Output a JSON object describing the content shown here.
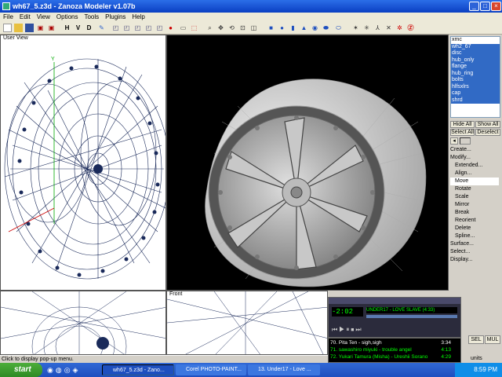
{
  "window": {
    "title": "wh67_5.z3d - Zanoza Modeler v1.07b"
  },
  "menu": [
    "File",
    "Edit",
    "View",
    "Options",
    "Tools",
    "Plugins",
    "Help"
  ],
  "toolbar_text_buttons": [
    "H",
    "V",
    "D"
  ],
  "viewports": {
    "top_left": "User View",
    "bottom_left": "",
    "bottom_mid": "Front"
  },
  "objects": [
    "xmc",
    "wh2_67",
    "disc",
    "hub_only",
    "flange",
    "hub_ring",
    "bolts",
    "hlfsxlrs",
    "cap",
    "shrd"
  ],
  "panel": {
    "hide_all": "Hide All",
    "show_all": "Show All",
    "select_all": "Select All",
    "deselect": "Deselect"
  },
  "commands": [
    {
      "label": "Create...",
      "sub": false
    },
    {
      "label": "Modify...",
      "sub": false
    },
    {
      "label": "Extended...",
      "sub": true
    },
    {
      "label": "Align...",
      "sub": true
    },
    {
      "label": "Move",
      "sub": true,
      "selected": true
    },
    {
      "label": "Rotate",
      "sub": true
    },
    {
      "label": "Scale",
      "sub": true
    },
    {
      "label": "Mirror",
      "sub": true
    },
    {
      "label": "Break",
      "sub": true
    },
    {
      "label": "Reorient",
      "sub": true
    },
    {
      "label": "Delete",
      "sub": true
    },
    {
      "label": "Spline...",
      "sub": true
    },
    {
      "label": "Surface...",
      "sub": false
    },
    {
      "label": "Select...",
      "sub": false
    },
    {
      "label": "Display...",
      "sub": false
    }
  ],
  "bottom_buttons": [
    "SEL",
    "MUL"
  ],
  "units_label": "units",
  "status_text": "Click to display pop-up menu.",
  "taskbar": {
    "start": "start",
    "tasks": [
      "wh67_5.z3d - Zano...",
      "Corel PHOTO-PAINT...",
      "13. Under17 - Love ..."
    ],
    "clock": "8:59 PM"
  },
  "winamp": {
    "time": "-2:02",
    "title_scroll": "UNDER17 - LOVE SLAVE (4:33)",
    "playlist": [
      {
        "text": "70. Pita Ten - sigh,sigh",
        "time": "3:34"
      },
      {
        "text": "71. sawashiro miyuki - trouble angel",
        "time": "4:13"
      },
      {
        "text": "72. Yukari Tamura (Misha) - Ureshii Sorano",
        "time": "4:29"
      }
    ]
  },
  "colors": {
    "selected": "#316ac5",
    "wire": "#1a2a5a"
  }
}
